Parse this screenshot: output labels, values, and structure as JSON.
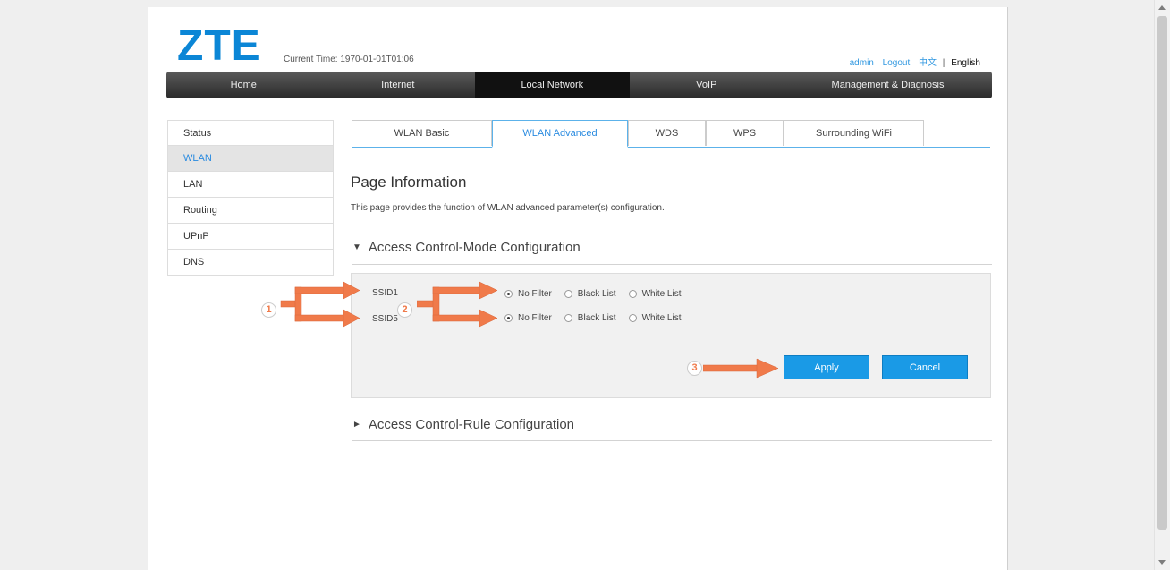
{
  "header": {
    "logo": "ZTE",
    "current_time": "Current Time: 1970-01-01T01:06",
    "user": "admin",
    "logout": "Logout",
    "lang_cn": "中文",
    "lang_sep": "|",
    "lang_en": "English"
  },
  "nav": {
    "items": [
      {
        "label": "Home"
      },
      {
        "label": "Internet"
      },
      {
        "label": "Local Network"
      },
      {
        "label": "VoIP"
      },
      {
        "label": "Management & Diagnosis"
      }
    ],
    "active": "Local Network"
  },
  "sidebar": {
    "items": [
      {
        "label": "Status"
      },
      {
        "label": "WLAN"
      },
      {
        "label": "LAN"
      },
      {
        "label": "Routing"
      },
      {
        "label": "UPnP"
      },
      {
        "label": "DNS"
      }
    ],
    "active": "WLAN"
  },
  "tabs": {
    "items": [
      {
        "label": "WLAN Basic"
      },
      {
        "label": "WLAN Advanced"
      },
      {
        "label": "WDS"
      },
      {
        "label": "WPS"
      },
      {
        "label": "Surrounding WiFi"
      }
    ],
    "active": "WLAN Advanced"
  },
  "main": {
    "title": "Page Information",
    "description": "This page provides the function of WLAN advanced parameter(s) configuration.",
    "section_mode": "Access Control-Mode Configuration",
    "section_rule": "Access Control-Rule Configuration",
    "ssids": [
      {
        "label": "SSID1",
        "selected": "No Filter"
      },
      {
        "label": "SSID5",
        "selected": "No Filter"
      }
    ],
    "filter_options": [
      "No Filter",
      "Black List",
      "White List"
    ],
    "apply_label": "Apply",
    "cancel_label": "Cancel"
  },
  "annotations": {
    "badge_1": "1",
    "badge_2": "2",
    "badge_3": "3",
    "arrow_color": "#f07a4a"
  },
  "colors": {
    "brand": "#0b86d6",
    "link": "#2f97e0",
    "button": "#1a9ae6"
  }
}
